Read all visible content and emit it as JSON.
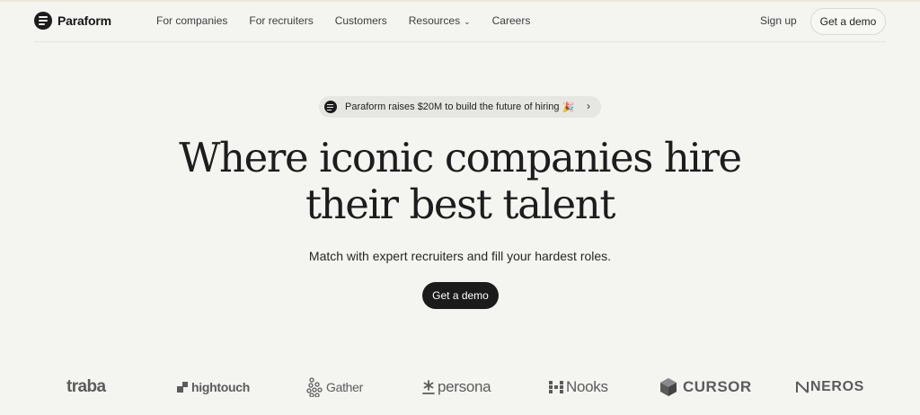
{
  "nav": {
    "brand": "Paraform",
    "links": [
      {
        "label": "For companies"
      },
      {
        "label": "For recruiters"
      },
      {
        "label": "Customers"
      },
      {
        "label": "Resources",
        "chevron": "⌄"
      },
      {
        "label": "Careers"
      }
    ],
    "signup": "Sign up",
    "demo": "Get a demo"
  },
  "announcement": {
    "text": "Paraform raises $20M to build the future of hiring",
    "emoji": "🎉",
    "arrow": "›"
  },
  "hero": {
    "line1": "Where iconic companies hire",
    "line2": "their best talent",
    "subtitle": "Match with expert recruiters and fill your hardest roles.",
    "cta": "Get a demo"
  },
  "logos": {
    "items": [
      {
        "name": "traba",
        "icon": "none"
      },
      {
        "name": "hightouch",
        "icon": "hightouch-mark-icon"
      },
      {
        "name": "Gather",
        "icon": "gather-dots-icon"
      },
      {
        "name": "persona",
        "icon": "asterisk-icon"
      },
      {
        "name": "Nooks",
        "icon": "nooks-mark-icon"
      },
      {
        "name": "CURSOR",
        "icon": "cube-icon"
      },
      {
        "name": "NEROS",
        "icon": "neros-mark-icon"
      }
    ]
  },
  "colors": {
    "background": "#f4f5f0",
    "primary": "#1b1b1b",
    "pill": "#e6e7e2",
    "logo_gray": "#5b5b5b"
  }
}
